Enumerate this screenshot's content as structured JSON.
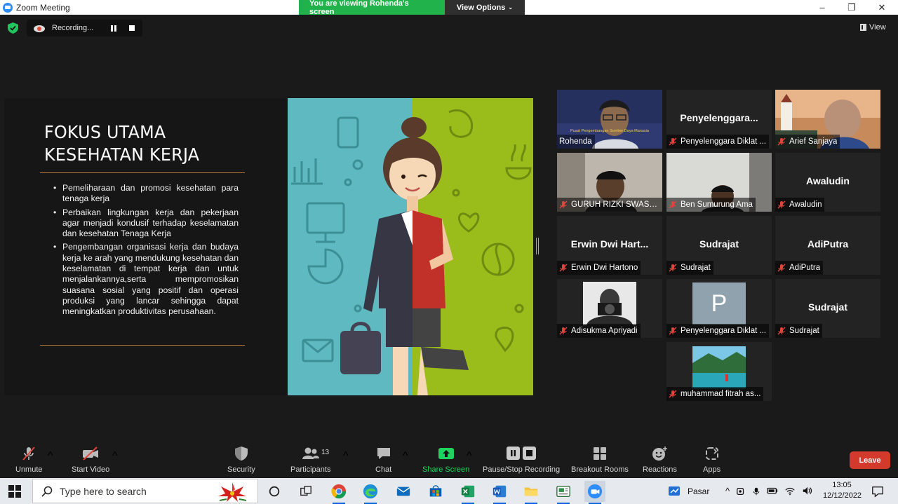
{
  "window": {
    "title": "Zoom Meeting",
    "controls": {
      "minimize": "–",
      "maximize": "❐",
      "close": "✕"
    }
  },
  "share_banner": {
    "viewing_text": "You are viewing Rohenda's screen",
    "view_options": "View Options",
    "accent": "#21b24b"
  },
  "recording": {
    "status": "Recording..."
  },
  "view_label": "View",
  "slide": {
    "title_line1": "FOKUS UTAMA",
    "title_line2": "KESEHATAN KERJA",
    "bullets": [
      "Pemeliharaan dan promosi kesehatan para tenaga kerja",
      "Perbaikan lingkungan kerja dan pekerjaan agar menjadi kondusif terhadap keselamatan dan kesehatan Tenaga Kerja",
      "Pengembangan organisasi kerja dan budaya kerja ke arah yang mendukung kesehatan dan keselamatan di tempat kerja dan untuk menjalankannya,serta mempromosikan suasana sosial yang positif dan operasi produksi yang lancar sehingga dapat meningkatkan produktivitas perusahaan."
    ]
  },
  "participants": [
    {
      "label": "Rohenda",
      "name_display": "",
      "video_caption": "Pusat Pengembangan Sumber Daya Manusia"
    },
    {
      "label": "Penyelenggara Diklat ...",
      "name_display": "Penyelenggara..."
    },
    {
      "label": "Arief Sanjaya",
      "name_display": ""
    },
    {
      "label": "GURUH RIZKI SWASTI...",
      "name_display": ""
    },
    {
      "label": "Ben Sumurung Ama",
      "name_display": ""
    },
    {
      "label": "Awaludin",
      "name_display": "Awaludin"
    },
    {
      "label": "Erwin Dwi Hartono",
      "name_display": "Erwin Dwi Hart..."
    },
    {
      "label": "Sudrajat",
      "name_display": "Sudrajat"
    },
    {
      "label": "AdiPutra",
      "name_display": "AdiPutra"
    },
    {
      "label": "Adisukma Apriyadi",
      "name_display": ""
    },
    {
      "label": "Penyelenggara Diklat ...",
      "name_display": "",
      "avatar_letter": "P"
    },
    {
      "label": "Sudrajat",
      "name_display": "Sudrajat"
    },
    {
      "label": "muhammad fitrah as...",
      "name_display": ""
    }
  ],
  "toolbar": {
    "unmute": "Unmute",
    "start_video": "Start Video",
    "security": "Security",
    "participants": "Participants",
    "participants_count": "13",
    "chat": "Chat",
    "share_screen": "Share Screen",
    "pause_stop_recording": "Pause/Stop Recording",
    "breakout_rooms": "Breakout Rooms",
    "reactions": "Reactions",
    "apps": "Apps",
    "leave": "Leave",
    "share_color": "#1fd35f",
    "leave_color": "#d33a2c"
  },
  "taskbar": {
    "search_placeholder": "Type here to search",
    "market_label": "Pasar",
    "time": "13:05",
    "date": "12/12/2022"
  }
}
